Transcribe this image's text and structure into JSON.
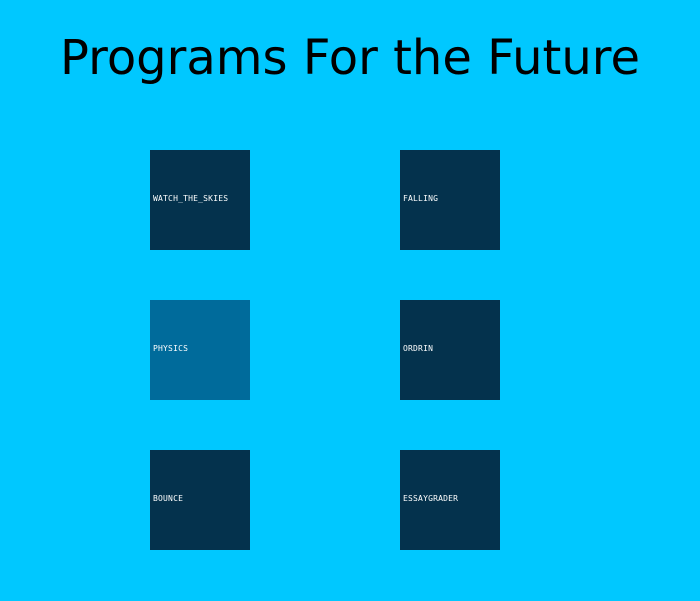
{
  "title": "Programs For the Future",
  "colors": {
    "background": "#00c8ff",
    "tile": "#04324d",
    "tile_active": "#006b9b",
    "label": "#ffffff",
    "title": "#000000"
  },
  "programs": [
    {
      "label": "WATCH_THE_SKIES",
      "active": false
    },
    {
      "label": "FALLING",
      "active": false
    },
    {
      "label": "PHYSICS",
      "active": true
    },
    {
      "label": "ORDRIN",
      "active": false
    },
    {
      "label": "BOUNCE",
      "active": false
    },
    {
      "label": "ESSAYGRADER",
      "active": false
    }
  ]
}
